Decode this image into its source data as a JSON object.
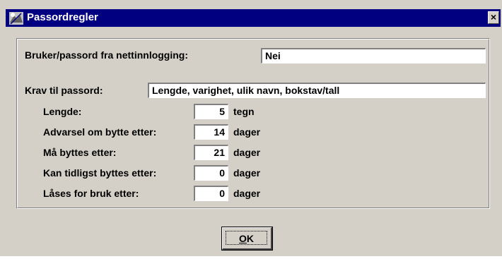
{
  "window": {
    "title": "Passordregler",
    "close_glyph": "×"
  },
  "sso": {
    "label": "Bruker/passord fra nettinnlogging:",
    "value": "Nei"
  },
  "requirements": {
    "label": "Krav til passord:",
    "value": "Lengde, varighet, ulik navn, bokstav/tall"
  },
  "rules": [
    {
      "label": "Lengde:",
      "value": "5",
      "unit": "tegn"
    },
    {
      "label": "Advarsel om bytte etter:",
      "value": "14",
      "unit": "dager"
    },
    {
      "label": "Må byttes etter:",
      "value": "21",
      "unit": "dager"
    },
    {
      "label": "Kan tidligst byttes etter:",
      "value": "0",
      "unit": "dager"
    },
    {
      "label": "Låses for bruk etter:",
      "value": "0",
      "unit": "dager"
    }
  ],
  "ok_button": {
    "mnemonic": "O",
    "rest": "K"
  }
}
